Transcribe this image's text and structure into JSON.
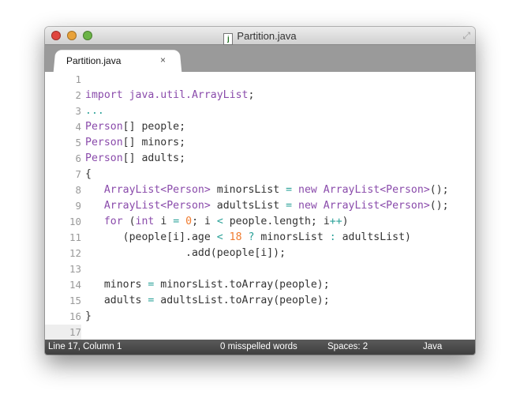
{
  "window": {
    "title": "Partition.java",
    "file_icon": "java-file-icon"
  },
  "tab": {
    "label": "Partition.java",
    "close": "×"
  },
  "colors": {
    "keyword": "#8a4bab",
    "operator": "#2aa198",
    "number": "#f07b2e"
  },
  "editor": {
    "current_line": 17,
    "lines": [
      {
        "n": "1",
        "tokens": []
      },
      {
        "n": "2",
        "tokens": [
          [
            "kw",
            "import"
          ],
          [
            "pl",
            " "
          ],
          [
            "ty",
            "java.util.ArrayList"
          ],
          [
            "pl",
            ";"
          ]
        ]
      },
      {
        "n": "3",
        "tokens": [
          [
            "op",
            "..."
          ]
        ]
      },
      {
        "n": "4",
        "tokens": [
          [
            "ty",
            "Person"
          ],
          [
            "pl",
            "[] people;"
          ]
        ]
      },
      {
        "n": "5",
        "tokens": [
          [
            "ty",
            "Person"
          ],
          [
            "pl",
            "[] minors;"
          ]
        ]
      },
      {
        "n": "6",
        "tokens": [
          [
            "ty",
            "Person"
          ],
          [
            "pl",
            "[] adults;"
          ]
        ]
      },
      {
        "n": "7",
        "tokens": [
          [
            "pl",
            "{"
          ]
        ]
      },
      {
        "n": "8",
        "tokens": [
          [
            "pl",
            "   "
          ],
          [
            "ty",
            "ArrayList<Person>"
          ],
          [
            "pl",
            " minorsList "
          ],
          [
            "op",
            "="
          ],
          [
            "pl",
            " "
          ],
          [
            "kw",
            "new"
          ],
          [
            "pl",
            " "
          ],
          [
            "ty",
            "ArrayList<Person>"
          ],
          [
            "pl",
            "();"
          ]
        ]
      },
      {
        "n": "9",
        "tokens": [
          [
            "pl",
            "   "
          ],
          [
            "ty",
            "ArrayList<Person>"
          ],
          [
            "pl",
            " adultsList "
          ],
          [
            "op",
            "="
          ],
          [
            "pl",
            " "
          ],
          [
            "kw",
            "new"
          ],
          [
            "pl",
            " "
          ],
          [
            "ty",
            "ArrayList<Person>"
          ],
          [
            "pl",
            "();"
          ]
        ]
      },
      {
        "n": "10",
        "tokens": [
          [
            "pl",
            "   "
          ],
          [
            "kw",
            "for"
          ],
          [
            "pl",
            " ("
          ],
          [
            "kw",
            "int"
          ],
          [
            "pl",
            " i "
          ],
          [
            "op",
            "="
          ],
          [
            "pl",
            " "
          ],
          [
            "num",
            "0"
          ],
          [
            "pl",
            "; i "
          ],
          [
            "op",
            "<"
          ],
          [
            "pl",
            " people.length; i"
          ],
          [
            "op",
            "++"
          ],
          [
            "pl",
            ")"
          ]
        ]
      },
      {
        "n": "11",
        "tokens": [
          [
            "pl",
            "      (people[i].age "
          ],
          [
            "op",
            "<"
          ],
          [
            "pl",
            " "
          ],
          [
            "num",
            "18"
          ],
          [
            "pl",
            " "
          ],
          [
            "op",
            "?"
          ],
          [
            "pl",
            " minorsList "
          ],
          [
            "op",
            ":"
          ],
          [
            "pl",
            " adultsList)"
          ]
        ]
      },
      {
        "n": "12",
        "tokens": [
          [
            "pl",
            "                .add(people[i]);"
          ]
        ]
      },
      {
        "n": "13",
        "tokens": []
      },
      {
        "n": "14",
        "tokens": [
          [
            "pl",
            "   minors "
          ],
          [
            "op",
            "="
          ],
          [
            "pl",
            " minorsList.toArray(people);"
          ]
        ]
      },
      {
        "n": "15",
        "tokens": [
          [
            "pl",
            "   adults "
          ],
          [
            "op",
            "="
          ],
          [
            "pl",
            " adultsList.toArray(people);"
          ]
        ]
      },
      {
        "n": "16",
        "tokens": [
          [
            "pl",
            "}"
          ]
        ]
      },
      {
        "n": "17",
        "tokens": []
      }
    ]
  },
  "status": {
    "position": "Line 17, Column 1",
    "spelling": "0 misspelled words",
    "indent": "Spaces: 2",
    "syntax": "Java"
  }
}
